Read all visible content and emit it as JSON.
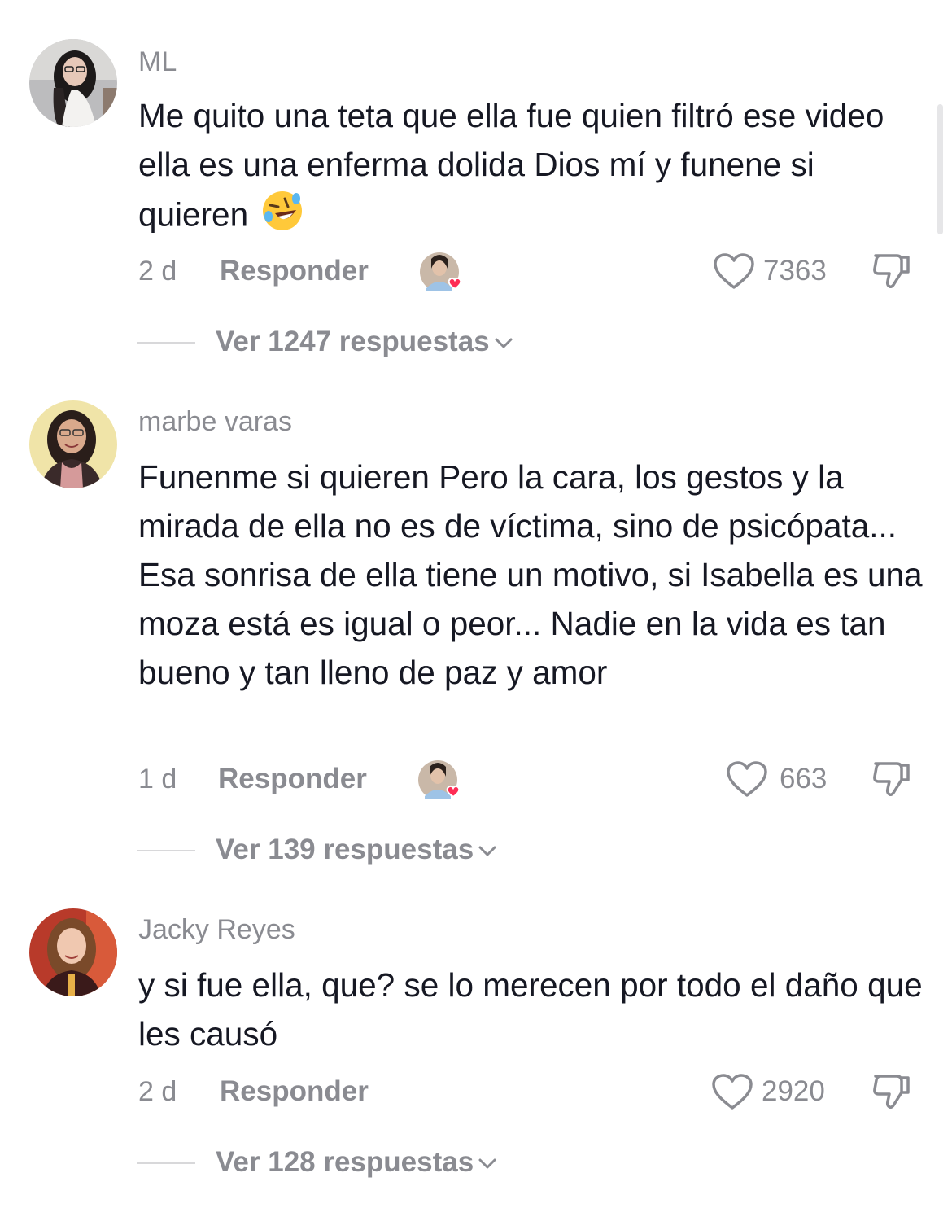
{
  "comments": [
    {
      "username": "ML",
      "text": "Me quito una teta que ella fue quien filtró ese video ella es una enferma dolida Dios mí y funene si quieren",
      "emoji": "rolling-on-floor-laughing-emoji",
      "time": "2 d",
      "reply_label": "Responder",
      "likes": "7363",
      "view_replies": "Ver 1247 respuestas",
      "creator_liked": true
    },
    {
      "username": "marbe varas",
      "text": "Funenme si quieren Pero la cara, los gestos y la mirada de ella no es de víctima, sino de psicópata... Esa sonrisa de ella tiene un motivo, si Isabella es una moza está es igual o peor... Nadie en la vida es tan bueno y tan lleno de paz y amor",
      "time": "1 d",
      "reply_label": "Responder",
      "likes": "663",
      "view_replies": "Ver 139 respuestas",
      "creator_liked": true
    },
    {
      "username": "Jacky Reyes",
      "text": "y si fue ella, que? se lo merecen por todo el daño que les causó",
      "time": "2 d",
      "reply_label": "Responder",
      "likes": "2920",
      "view_replies": "Ver 128 respuestas",
      "creator_liked": false
    }
  ],
  "colors": {
    "text": "#161823",
    "secondary": "#8a8b91",
    "heart_badge": "#fe2c55"
  }
}
